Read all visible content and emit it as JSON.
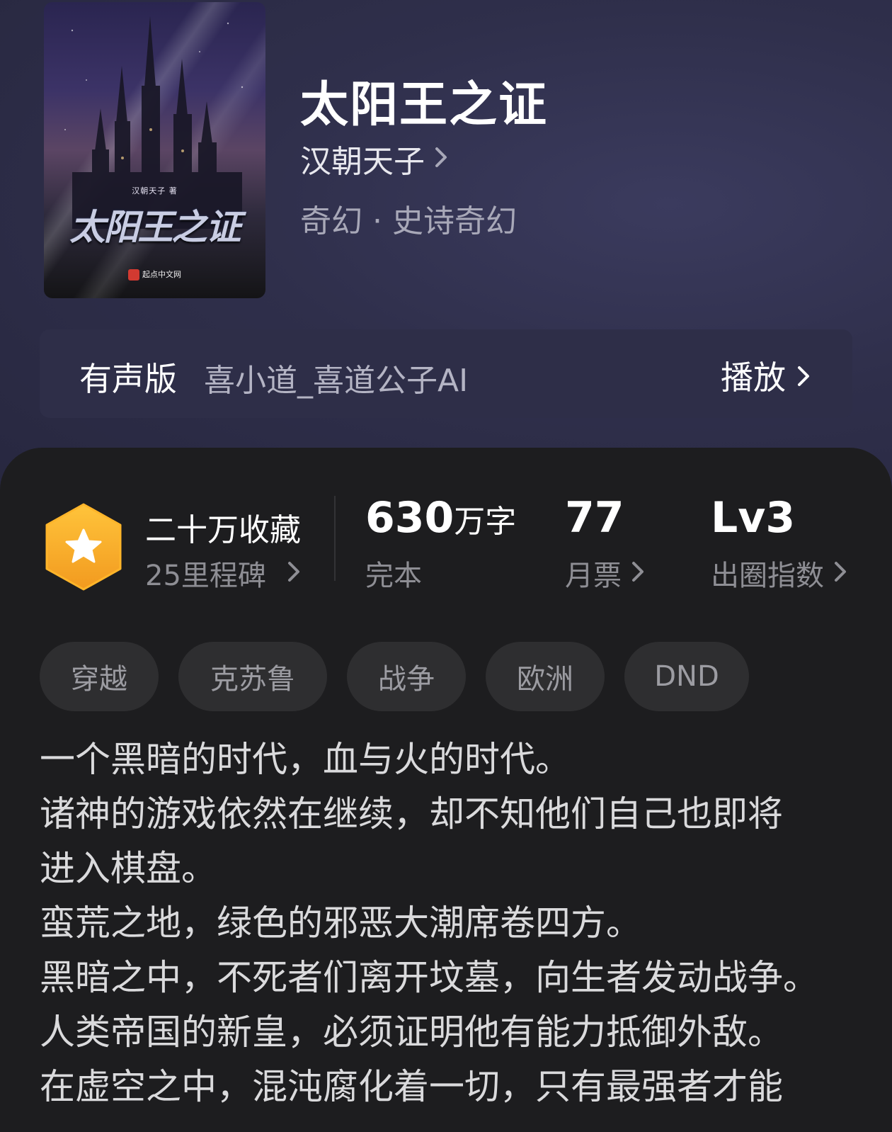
{
  "book": {
    "title": "太阳王之证",
    "author": "汉朝天子",
    "genre": "奇幻 · 史诗奇幻",
    "cover": {
      "author_text": "汉朝天子 著",
      "title_text": "太阳王之证",
      "publisher_text": "起点中文网"
    }
  },
  "audio": {
    "label": "有声版",
    "narrator": "喜小道_喜道公子AI",
    "play_label": "播放"
  },
  "stats": {
    "favorites": {
      "main": "二十万收藏",
      "sub": "25里程碑"
    },
    "words": {
      "value": "630",
      "unit": "万字",
      "label": "完本"
    },
    "monthly_votes": {
      "value": "77",
      "label": "月票"
    },
    "breakout": {
      "value": "Lv3",
      "label": "出圈指数"
    }
  },
  "tags": [
    "穿越",
    "克苏鲁",
    "战争",
    "欧洲",
    "DND"
  ],
  "description": [
    "一个黑暗的时代，血与火的时代。",
    "诸神的游戏依然在继续，却不知他们自己也即将",
    "进入棋盘。",
    "蛮荒之地，绿色的邪恶大潮席卷四方。",
    "黑暗之中，不死者们离开坟墓，向生者发动战争。",
    "人类帝国的新皇，必须证明他有能力抵御外敌。",
    "在虚空之中，混沌腐化着一切，只有最强者才能"
  ],
  "colors": {
    "hero_bg": "#2f2f4b",
    "panel_bg": "#1d1d1f",
    "badge_orange": "#f5a623",
    "tag_bg": "#2e2e30"
  },
  "icons": [
    "star-badge-icon",
    "chevron-right-icon",
    "publisher-logo-icon"
  ]
}
